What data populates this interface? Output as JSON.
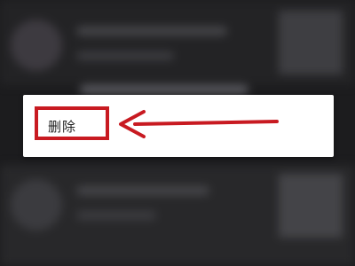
{
  "context_menu": {
    "items": [
      {
        "label": "删除"
      }
    ]
  },
  "annotation": {
    "color": "#c81a21",
    "arrow_direction": "left",
    "target": "删除"
  }
}
